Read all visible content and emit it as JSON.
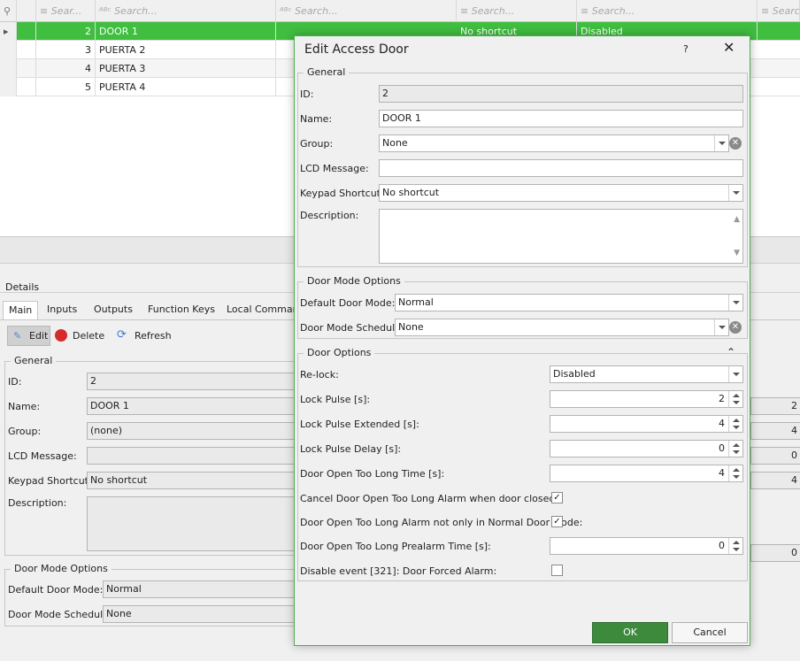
{
  "grid": {
    "search_placeholder": "Search...",
    "search_short": "Sear...",
    "search_short2": "Searc",
    "rows": [
      {
        "id": "2",
        "name": "DOOR 1",
        "shortcut": "No shortcut",
        "relock": "Disabled"
      },
      {
        "id": "3",
        "name": "PUERTA 2",
        "shortcut": "",
        "relock": ""
      },
      {
        "id": "4",
        "name": "PUERTA 3",
        "shortcut": "",
        "relock": ""
      },
      {
        "id": "5",
        "name": "PUERTA 4",
        "shortcut": "",
        "relock": ""
      }
    ]
  },
  "details": {
    "title": "Details",
    "tabs": [
      "Main",
      "Inputs",
      "Outputs",
      "Function Keys",
      "Local Commands"
    ],
    "toolbar": {
      "edit": "Edit",
      "delete": "Delete",
      "refresh": "Refresh"
    },
    "general_title": "General",
    "labels": {
      "id": "ID:",
      "name": "Name:",
      "group": "Group:",
      "lcd": "LCD Message:",
      "keypad": "Keypad Shortcut:",
      "description": "Description:"
    },
    "values": {
      "id": "2",
      "name": "DOOR 1",
      "group": "(none)",
      "lcd": "",
      "keypad": "No shortcut"
    },
    "door_mode_title": "Door Mode Options",
    "door_mode_labels": {
      "default": "Default Door Mode:",
      "schedule": "Door Mode Schedule:"
    },
    "door_mode_values": {
      "default": "Normal",
      "schedule": "None"
    },
    "right_values": [
      "2",
      "4",
      "0",
      "4",
      "0"
    ]
  },
  "dialog": {
    "title": "Edit Access Door",
    "help": "?",
    "general": {
      "title": "General",
      "id_label": "ID:",
      "id_value": "2",
      "name_label": "Name:",
      "name_value": "DOOR 1",
      "group_label": "Group:",
      "group_value": "None",
      "lcd_label": "LCD Message:",
      "lcd_value": "",
      "keypad_label": "Keypad Shortcut:",
      "keypad_value": "No shortcut",
      "description_label": "Description:"
    },
    "door_mode": {
      "title": "Door Mode Options",
      "default_label": "Default Door Mode:",
      "default_value": "Normal",
      "schedule_label": "Door Mode Schedule:",
      "schedule_value": "None"
    },
    "door_options": {
      "title": "Door Options",
      "relock_label": "Re-lock:",
      "relock_value": "Disabled",
      "lock_pulse_label": "Lock Pulse [s]:",
      "lock_pulse_value": "2",
      "lock_pulse_ext_label": "Lock Pulse Extended [s]:",
      "lock_pulse_ext_value": "4",
      "lock_pulse_delay_label": "Lock Pulse Delay [s]:",
      "lock_pulse_delay_value": "0",
      "open_too_long_label": "Door Open Too Long Time [s]:",
      "open_too_long_value": "4",
      "cancel_alarm_label": "Cancel Door Open Too Long Alarm when door closed:",
      "cancel_alarm_checked": "✓",
      "not_only_normal_label": "Door Open Too Long Alarm not only in Normal Door Mode:",
      "not_only_normal_checked": "✓",
      "prealarm_label": "Door Open Too Long Prealarm Time [s]:",
      "prealarm_value": "0",
      "disable_event_label": "Disable event [321]: Door Forced Alarm:",
      "disable_event_checked": ""
    },
    "ok_label": "OK",
    "cancel_label": "Cancel"
  },
  "colors": {
    "selected_row": "#3fbe3f",
    "ok_button": "#3d8a3d",
    "dialog_border": "#4caf50"
  }
}
